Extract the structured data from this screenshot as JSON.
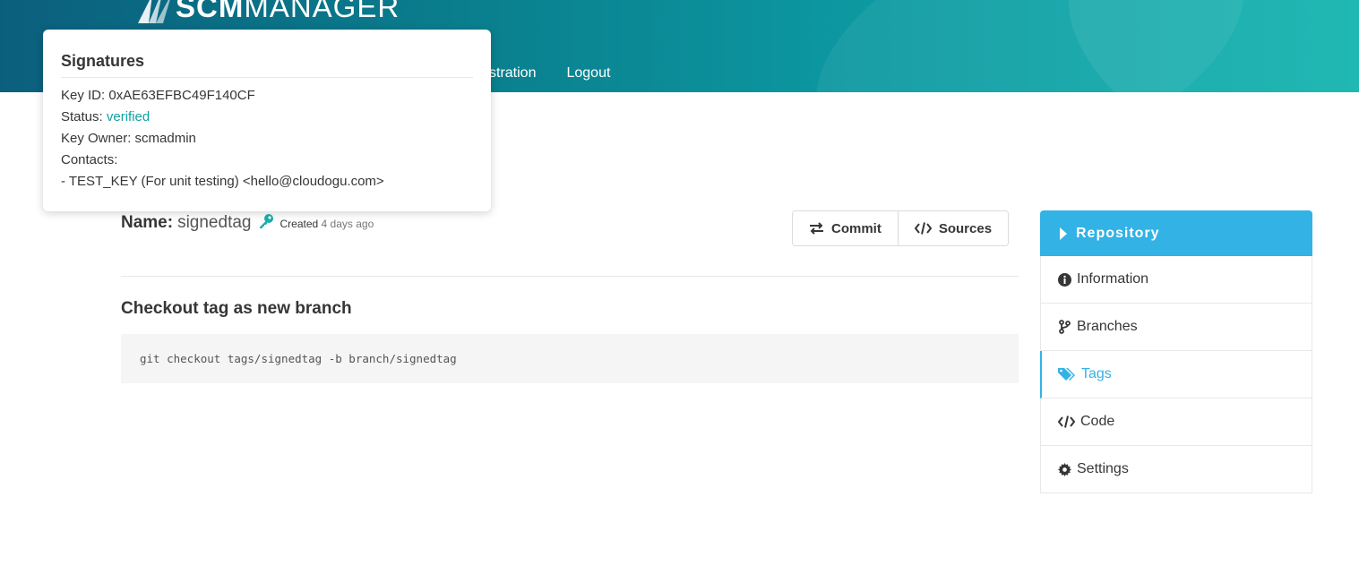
{
  "header": {
    "logo_strong": "SCM",
    "logo_thin": "MANAGER",
    "nav": [
      {
        "label": "inistration"
      },
      {
        "label": "Logout"
      }
    ]
  },
  "tooltip": {
    "title": "Signatures",
    "key_id": "Key ID: 0xAE63EFBC49F140CF",
    "status_prefix": "Status: ",
    "status_value": "verified",
    "key_owner": "Key Owner: scmadmin",
    "contacts_label": "Contacts:",
    "contact_line": "- TEST_KEY (For unit testing) <hello@cloudogu.com>"
  },
  "tag": {
    "name_label": "Name:",
    "name_value": "signedtag",
    "created_prefix": "Created",
    "created_ago": "4 days ago"
  },
  "buttons": {
    "commit": "Commit",
    "sources": "Sources"
  },
  "checkout": {
    "title": "Checkout tag as new branch",
    "command": "git checkout tags/signedtag -b branch/signedtag"
  },
  "sidebar": {
    "header": "Repository",
    "items": [
      {
        "label": "Information"
      },
      {
        "label": "Branches"
      },
      {
        "label": "Tags"
      },
      {
        "label": "Code"
      },
      {
        "label": "Settings"
      }
    ]
  },
  "colors": {
    "primary": "#33b2e5",
    "verified": "#12a0a0",
    "key_icon": "#1ab0ab"
  }
}
